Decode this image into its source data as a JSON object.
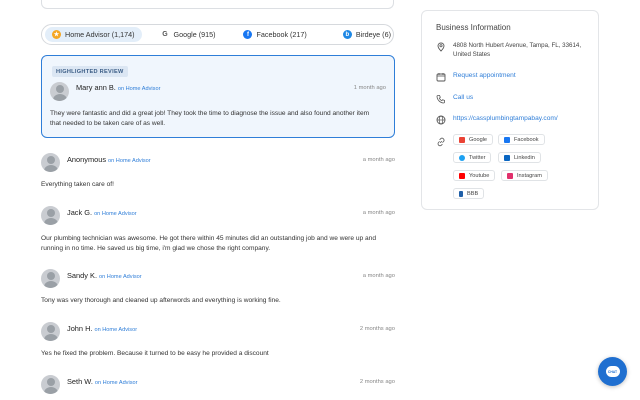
{
  "tabs": [
    {
      "label": "Home Advisor (1,174)",
      "icon": "home-advisor-icon",
      "active": true
    },
    {
      "label": "Google (915)",
      "icon": "google-icon",
      "active": false
    },
    {
      "label": "Facebook (217)",
      "icon": "facebook-icon",
      "active": false
    },
    {
      "label": "Birdeye (6)",
      "icon": "birdeye-icon",
      "active": false
    }
  ],
  "highlighted": {
    "badge": "HIGHLIGHTED REVIEW",
    "name": "Mary ann B.",
    "source": "on Home Advisor",
    "time": "1 month ago",
    "text": "They were fantastic and did a great job! They took the time to diagnose the issue and also found another item that needed to be taken care of as well."
  },
  "reviews": [
    {
      "name": "Anonymous",
      "source": "on Home Advisor",
      "time": "a month ago",
      "text": "Everything taken care of!"
    },
    {
      "name": "Jack G.",
      "source": "on Home Advisor",
      "time": "a month ago",
      "text": "Our plumbing technician was awesome. He got there within 45 minutes did an outstanding job and we were up and running in no time. He saved us big time, i'm glad we chose the right company."
    },
    {
      "name": "Sandy K.",
      "source": "on Home Advisor",
      "time": "a month ago",
      "text": "Tony was very thorough and cleaned up afterwords and everything is working fine."
    },
    {
      "name": "John H.",
      "source": "on Home Advisor",
      "time": "2 months ago",
      "text": "Yes he fixed the problem. Because it turned to be easy he provided a discount"
    },
    {
      "name": "Seth W.",
      "source": "on Home Advisor",
      "time": "2 months ago",
      "text": ""
    }
  ],
  "business": {
    "title": "Business Information",
    "address": "4808 North Hubert Avenue, Tampa, FL, 33614, United States",
    "appointment": "Request appointment",
    "call": "Call us",
    "website": "https://cassplumbingtampabay.com/",
    "social": [
      {
        "label": "Google",
        "icon": "google-icon",
        "color": "#ea4335"
      },
      {
        "label": "Facebook",
        "icon": "facebook-icon",
        "color": "#1877f2"
      },
      {
        "label": "Twitter",
        "icon": "twitter-icon",
        "color": "#1da1f2"
      },
      {
        "label": "Linkedin",
        "icon": "linkedin-icon",
        "color": "#0a66c2"
      },
      {
        "label": "Youtube",
        "icon": "youtube-icon",
        "color": "#ff0000"
      },
      {
        "label": "Instagram",
        "icon": "instagram-icon",
        "color": "#e1306c"
      },
      {
        "label": "BBB",
        "icon": "bbb-icon",
        "color": "#1f5fa8"
      }
    ]
  },
  "chat": {
    "label": "CHAT"
  },
  "colors": {
    "accent": "#2f7ed8",
    "highlight_bg": "#f0f6fd",
    "chat": "#1f6fd0"
  }
}
